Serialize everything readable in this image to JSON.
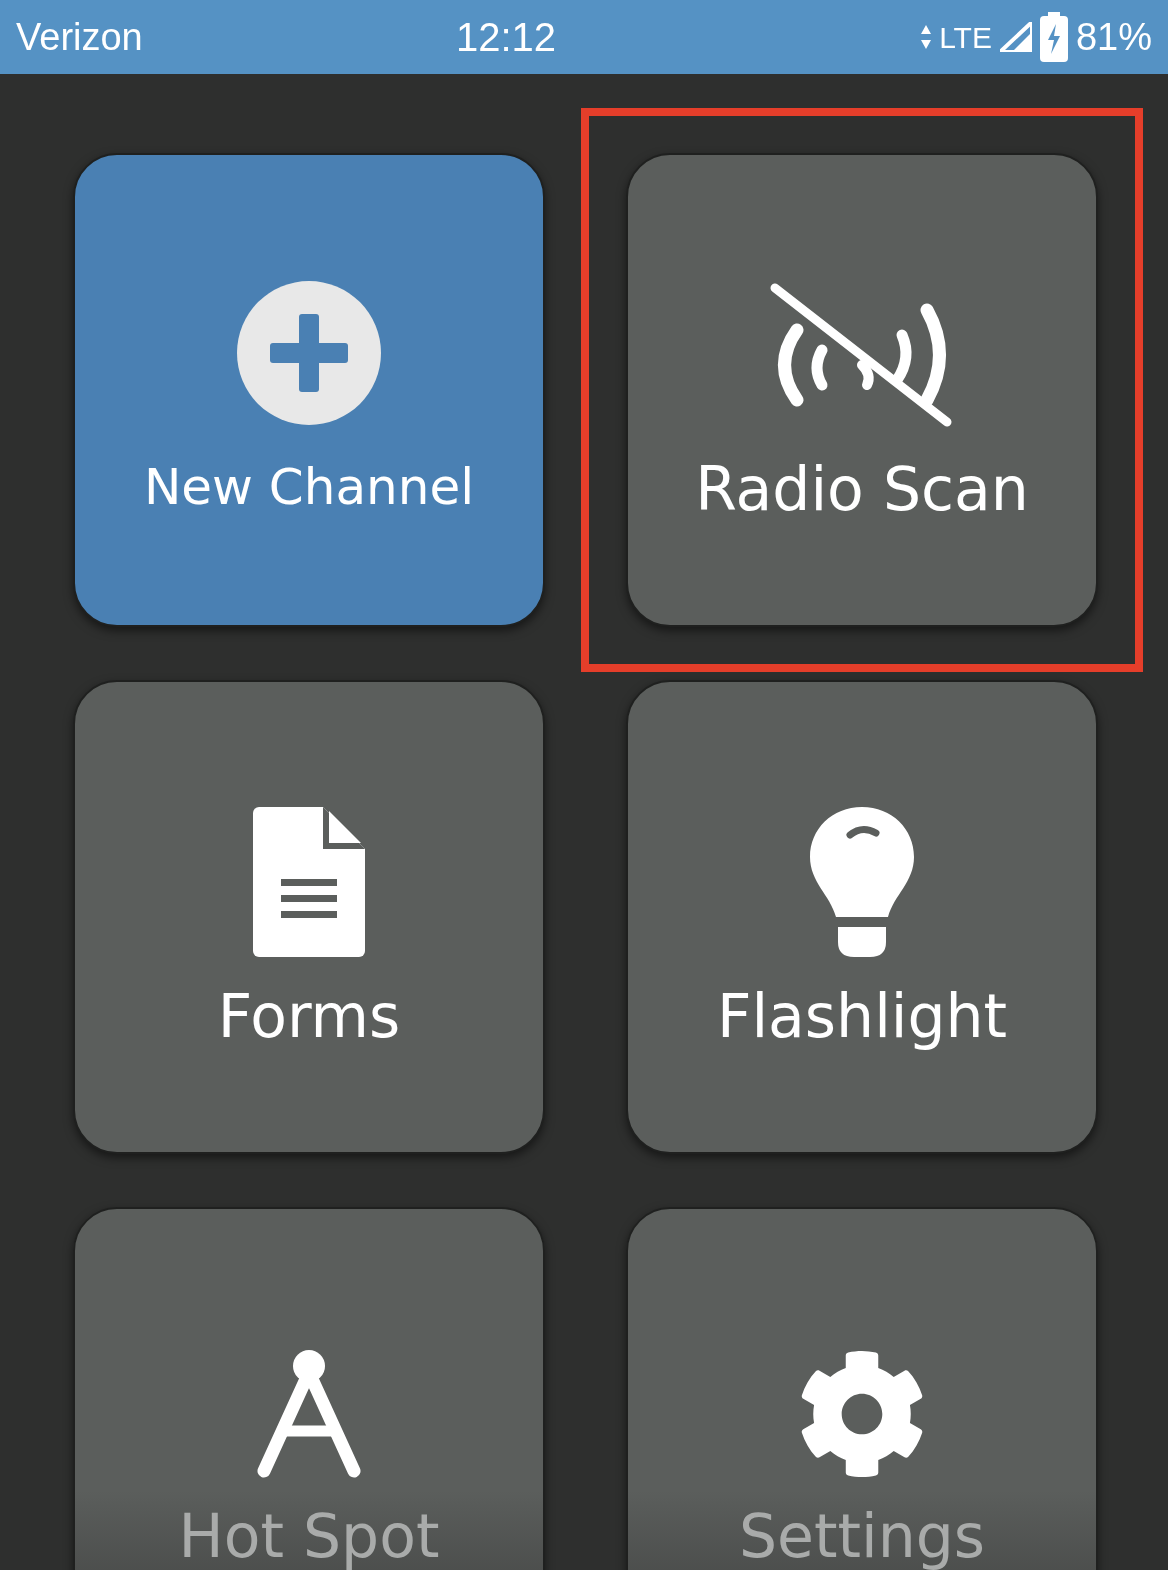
{
  "status_bar": {
    "carrier": "Verizon",
    "time": "12:12",
    "network": "LTE",
    "battery": "81%"
  },
  "tiles": [
    {
      "label": "New Channel",
      "active": true,
      "highlighted": false
    },
    {
      "label": "Radio Scan",
      "active": false,
      "highlighted": true
    },
    {
      "label": "Forms",
      "active": false,
      "highlighted": false
    },
    {
      "label": "Flashlight",
      "active": false,
      "highlighted": false
    },
    {
      "label": "Hot Spot",
      "active": false,
      "highlighted": false
    },
    {
      "label": "Settings",
      "active": false,
      "highlighted": false
    }
  ]
}
